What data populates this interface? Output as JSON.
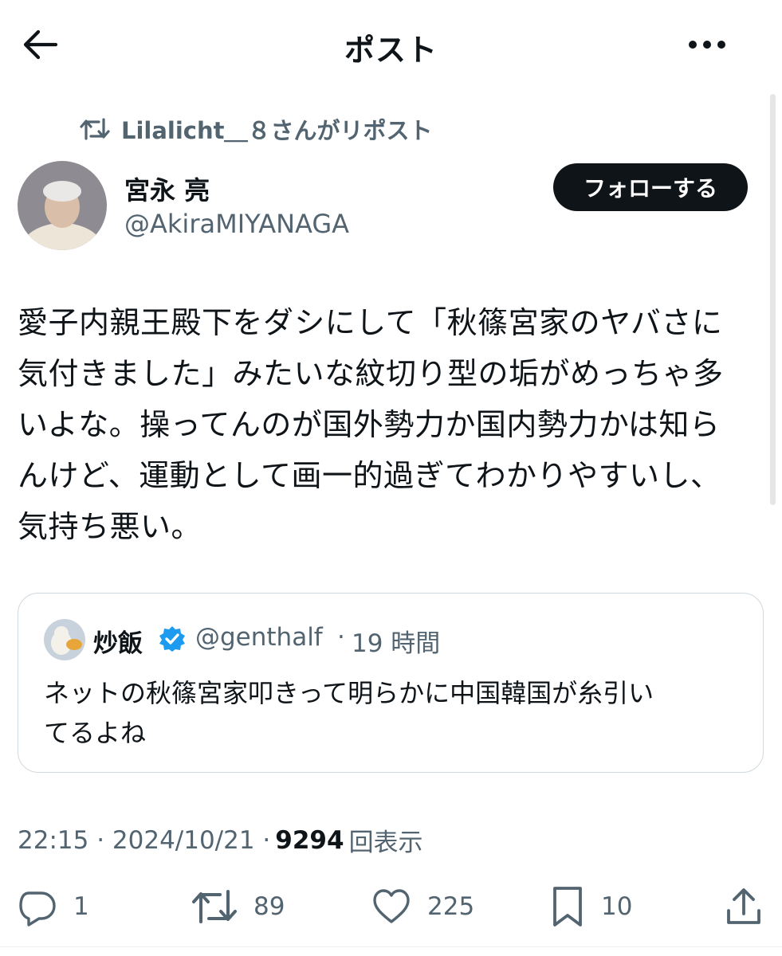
{
  "header": {
    "title": "ポスト"
  },
  "repost": {
    "text": "Lilalicht＿８さんがリポスト"
  },
  "author": {
    "name": "宮永 亮",
    "handle": "@AkiraMIYANAGA",
    "follow_label": "フォローする"
  },
  "post": {
    "lines": [
      "愛子内親王殿下をダシにして「秋篠宮家のヤバさに",
      "気付きました」みたいな紋切り型の垢がめっちゃ多",
      "いよな。操ってんのが国外勢力か国内勢力かは知ら",
      "んけど、運動として画一的過ぎてわかりやすいし、",
      "気持ち悪い。"
    ]
  },
  "quote": {
    "name": "炒飯",
    "handle": "@genthalf",
    "separator": "·",
    "time": "19 時間",
    "lines": [
      "ネットの秋篠宮家叩きって明らかに中国韓国が糸引い",
      "てるよね"
    ]
  },
  "meta": {
    "time": "22:15 · 2024/10/21 ·",
    "views_count": "9294",
    "views_label": "回表示"
  },
  "actions": {
    "replies": "1",
    "reposts": "89",
    "likes": "225",
    "bookmarks": "10"
  },
  "colors": {
    "text": "#0f1419",
    "secondary": "#536471",
    "border": "#cfd9de",
    "verified": "#1d9bf0",
    "button": "#0f1419"
  }
}
